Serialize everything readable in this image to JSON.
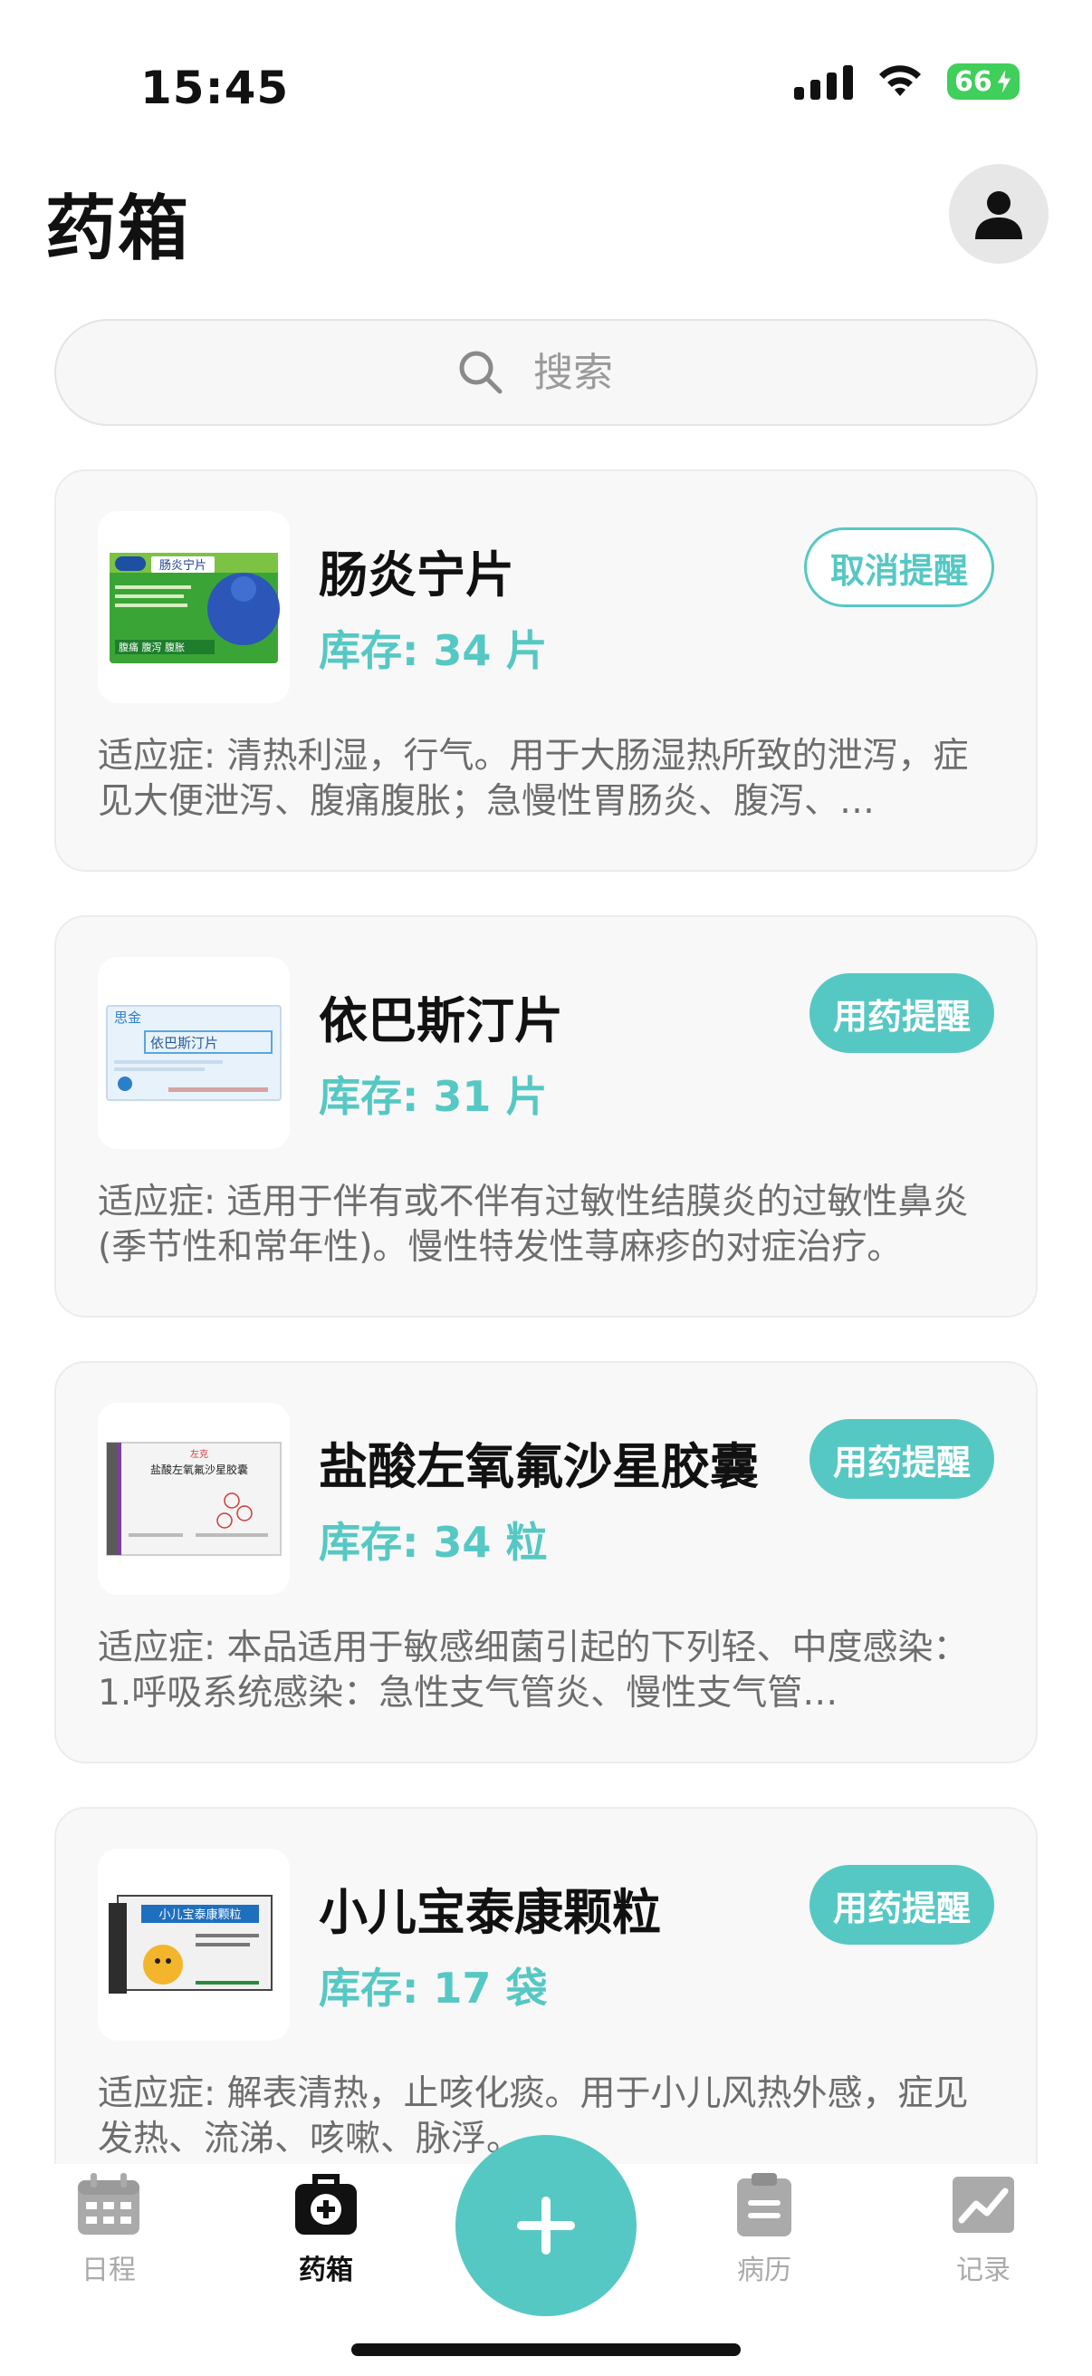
{
  "status_bar": {
    "time": "15:45",
    "battery": "66"
  },
  "header": {
    "title": "药箱"
  },
  "search": {
    "placeholder": "搜索"
  },
  "medicines": [
    {
      "name": "肠炎宁片",
      "stock": "库存: 34 片",
      "button": "取消提醒",
      "button_style": "outline",
      "description": "适应症: 清热利湿，行气。用于大肠湿热所致的泄泻，症见大便泄泻、腹痛腹胀；急慢性胃肠炎、腹泻、…",
      "package": {
        "brand": "肠炎宁片",
        "tagline": "腹痛 腹泻 腹胀"
      }
    },
    {
      "name": "依巴斯汀片",
      "stock": "库存: 31 片",
      "button": "用药提醒",
      "button_style": "filled",
      "description": "适应症: 适用于伴有或不伴有过敏性结膜炎的过敏性鼻炎 (季节性和常年性)。慢性特发性荨麻疹的对症治疗。",
      "package": {
        "brand": "思金",
        "label": "依巴斯汀片"
      }
    },
    {
      "name": "盐酸左氧氟沙星胶囊",
      "stock": "库存: 34 粒",
      "button": "用药提醒",
      "button_style": "filled",
      "description": "适应症: 本品适用于敏感细菌引起的下列轻、中度感染：1.呼吸系统感染：急性支气管炎、慢性支气管…",
      "package": {
        "brand": "左克",
        "label": "盐酸左氧氟沙星胶囊"
      }
    },
    {
      "name": "小儿宝泰康颗粒",
      "stock": "库存: 17 袋",
      "button": "用药提醒",
      "button_style": "filled",
      "description": "适应症: 解表清热，止咳化痰。用于小儿风热外感，症见发热、流涕、咳嗽、脉浮。",
      "package": {
        "label": "小儿宝泰康颗粒"
      }
    }
  ],
  "tabs": [
    {
      "label": "日程",
      "icon": "calendar-icon"
    },
    {
      "label": "药箱",
      "icon": "medkit-icon"
    },
    {
      "label": "病历",
      "icon": "clipboard-icon"
    },
    {
      "label": "记录",
      "icon": "chart-icon"
    }
  ],
  "fab": {
    "icon": "plus-icon"
  },
  "colors": {
    "accent": "#56c8c4",
    "card_bg": "#f8f8f8",
    "muted_text": "#6d6d6d",
    "tab_inactive": "#aaaaaa"
  }
}
